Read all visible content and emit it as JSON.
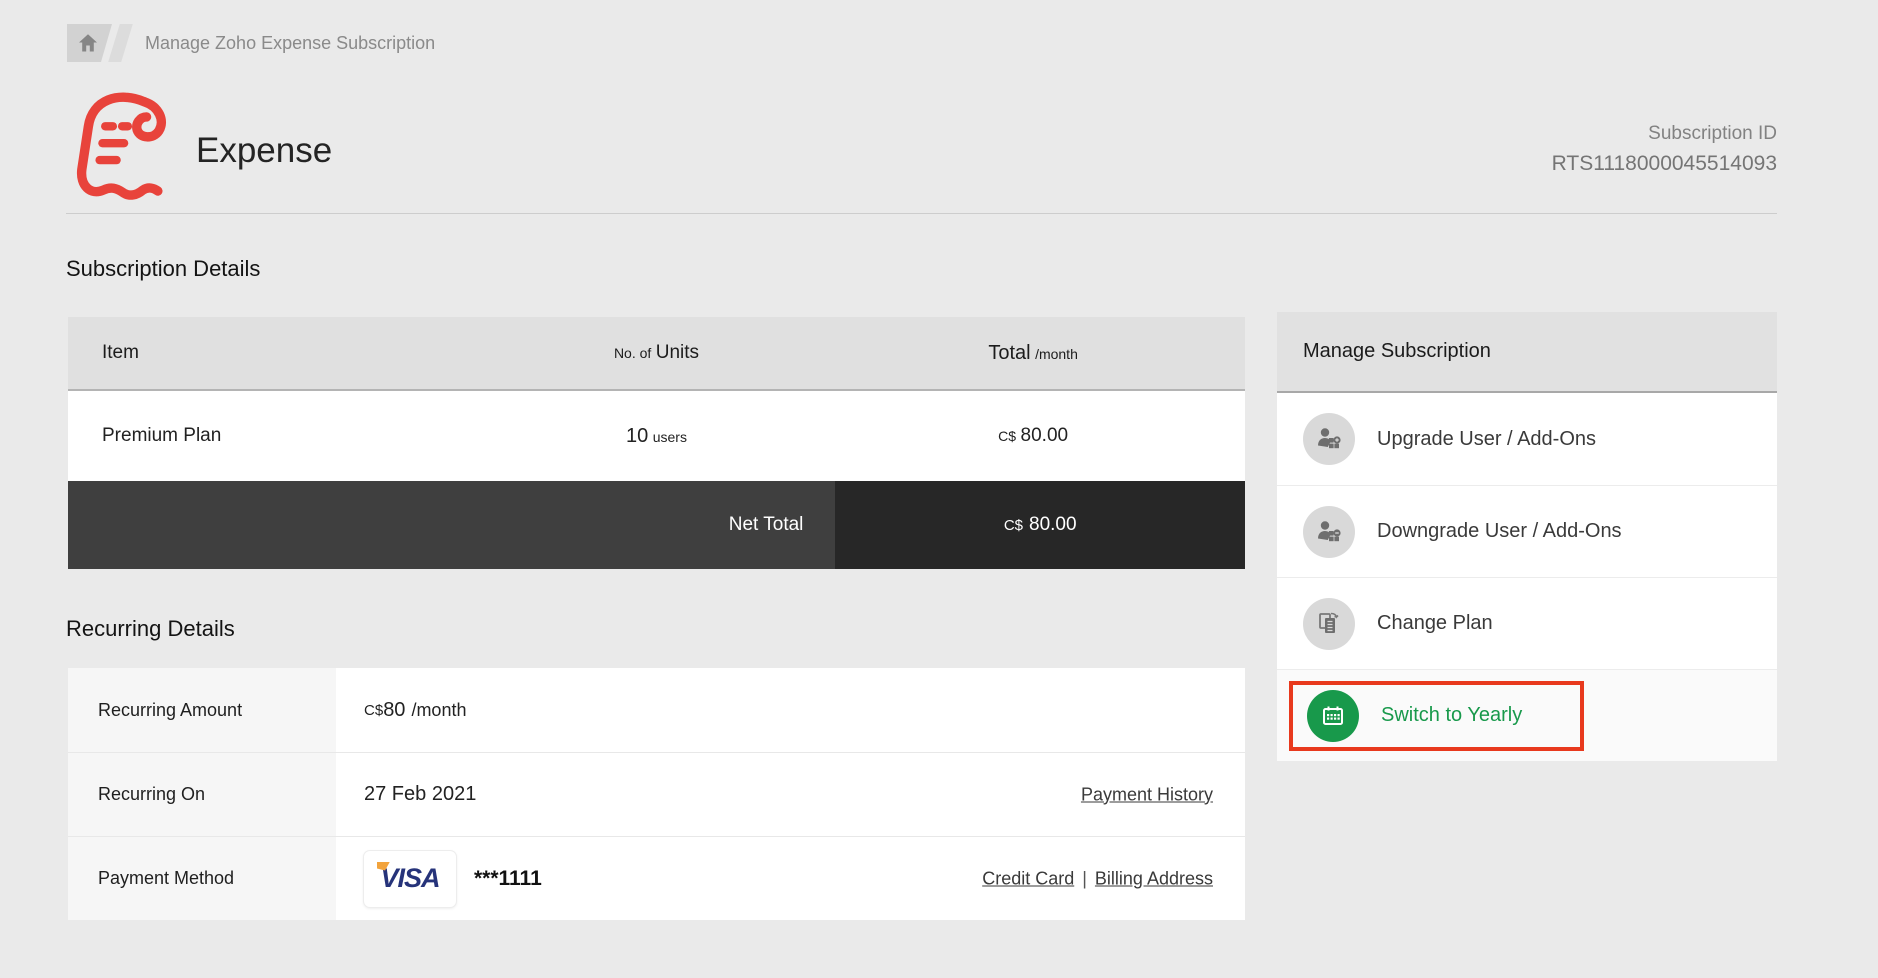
{
  "breadcrumb": {
    "label": "Manage Zoho Expense Subscription"
  },
  "header": {
    "app_name": "Expense",
    "subscription_id_label": "Subscription ID",
    "subscription_id_value": "RTS1118000045514093"
  },
  "subscription_details": {
    "title": "Subscription Details",
    "table": {
      "header": {
        "item": "Item",
        "units_prefix": "No. of",
        "units_label": "Units",
        "total_label": "Total",
        "total_suffix": "/month"
      },
      "row": {
        "item": "Premium Plan",
        "units_value": "10",
        "units_unit": "users",
        "currency": "C$",
        "amount": "80.00"
      },
      "net_total": {
        "label": "Net Total",
        "currency": "C$",
        "amount": "80.00"
      }
    }
  },
  "recurring_details": {
    "title": "Recurring Details",
    "recurring_amount": {
      "label": "Recurring Amount",
      "currency": "C$",
      "amount": "80",
      "suffix": "/month"
    },
    "recurring_on": {
      "label": "Recurring On",
      "value": "27 Feb 2021",
      "link": "Payment History"
    },
    "payment_method": {
      "label": "Payment Method",
      "card_brand": "VISA",
      "card_digits": "***1111",
      "link_credit_card": "Credit Card",
      "separator": "|",
      "link_billing_address": "Billing Address"
    }
  },
  "manage_subscription": {
    "title": "Manage Subscription",
    "items": [
      {
        "label": "Upgrade User / Add-Ons",
        "icon": "user-upgrade-icon"
      },
      {
        "label": "Downgrade User / Add-Ons",
        "icon": "user-downgrade-icon"
      },
      {
        "label": "Change Plan",
        "icon": "documents-icon"
      },
      {
        "label": "Switch to Yearly",
        "icon": "calendar-icon",
        "highlighted": true
      }
    ]
  },
  "colors": {
    "accent_green": "#18994b",
    "highlight_border_red": "#e8391d",
    "logo_red": "#e8433b",
    "net_total_left": "#3f3f3f",
    "net_total_right": "#272727",
    "visa_blue": "#26337a",
    "visa_orange": "#f2a33c"
  }
}
